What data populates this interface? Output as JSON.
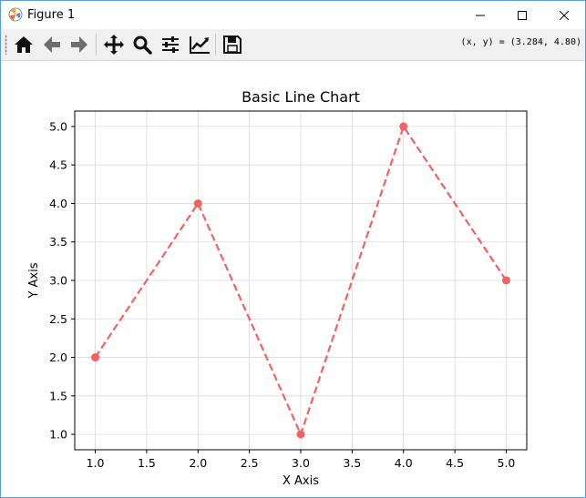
{
  "window": {
    "title": "Figure 1"
  },
  "toolbar": {
    "buttons": [
      {
        "name": "home-icon",
        "tooltip": "Home"
      },
      {
        "name": "back-icon",
        "tooltip": "Back"
      },
      {
        "name": "forward-icon",
        "tooltip": "Forward"
      },
      {
        "name": "pan-icon",
        "tooltip": "Pan"
      },
      {
        "name": "zoom-icon",
        "tooltip": "Zoom"
      },
      {
        "name": "subplots-icon",
        "tooltip": "Subplots"
      },
      {
        "name": "customize-icon",
        "tooltip": "Customize"
      },
      {
        "name": "save-icon",
        "tooltip": "Save"
      }
    ],
    "coords_readout": "(x, y) = (3.284, 4.80)"
  },
  "colors": {
    "line": "#f26262",
    "grid": "#d9d9d9",
    "toolbar_bg": "#f0f0f0"
  },
  "chart_data": {
    "type": "line",
    "title": "Basic Line Chart",
    "xlabel": "X Axis",
    "ylabel": "Y Axis",
    "x": [
      1,
      2,
      3,
      4,
      5
    ],
    "series": [
      {
        "values": [
          2,
          4,
          1,
          5,
          3
        ],
        "line_style": "dashed",
        "marker": "circle"
      }
    ],
    "xlim": [
      0.8,
      5.2
    ],
    "ylim": [
      0.8,
      5.2
    ],
    "xticks": [
      "1.0",
      "1.5",
      "2.0",
      "2.5",
      "3.0",
      "3.5",
      "4.0",
      "4.5",
      "5.0"
    ],
    "yticks": [
      "1.0",
      "1.5",
      "2.0",
      "2.5",
      "3.0",
      "3.5",
      "4.0",
      "4.5",
      "5.0"
    ],
    "grid": true
  }
}
